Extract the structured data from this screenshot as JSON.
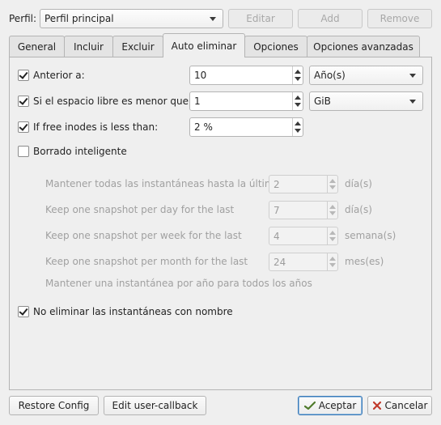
{
  "header": {
    "profile_label": "Perfil:",
    "profile_value": "Perfil principal",
    "edit_label": "Editar",
    "add_label": "Add",
    "remove_label": "Remove"
  },
  "tabs": [
    {
      "label": "General"
    },
    {
      "label": "Incluir"
    },
    {
      "label": "Excluir"
    },
    {
      "label": "Auto eliminar",
      "active": true
    },
    {
      "label": "Opciones"
    },
    {
      "label": "Opciones avanzadas"
    }
  ],
  "auto_remove": {
    "older_than": {
      "checked": true,
      "label": "Anterior a:",
      "value": "10",
      "unit": "Año(s)"
    },
    "free_space": {
      "checked": true,
      "label": "Si el espacio libre es menor que:",
      "value": "1",
      "unit": "GiB"
    },
    "free_inodes": {
      "checked": true,
      "label": "If free inodes is less than:",
      "value": "2 %"
    },
    "smart_remove": {
      "checked": false,
      "label": "Borrado inteligente"
    },
    "smart_rows": [
      {
        "label": "Mantener todas las instantáneas hasta la última",
        "value": "2",
        "unit": "día(s)"
      },
      {
        "label": "Keep one snapshot per day for the last",
        "value": "7",
        "unit": "día(s)"
      },
      {
        "label": "Keep one snapshot per week for the last",
        "value": "4",
        "unit": "semana(s)"
      },
      {
        "label": "Keep one snapshot per month for the last",
        "value": "24",
        "unit": "mes(es)"
      }
    ],
    "yearly_note": "Mantener una instantánea por año para todos los años",
    "keep_named": {
      "checked": true,
      "label": "No eliminar las instantáneas con nombre"
    }
  },
  "footer": {
    "restore_label": "Restore Config",
    "callback_label": "Edit user-callback",
    "accept_label": "Aceptar",
    "cancel_label": "Cancelar"
  },
  "colors": {
    "window_bg": "#efefef",
    "accept_icon": "#4f7a2b",
    "cancel_icon": "#c0392b"
  }
}
